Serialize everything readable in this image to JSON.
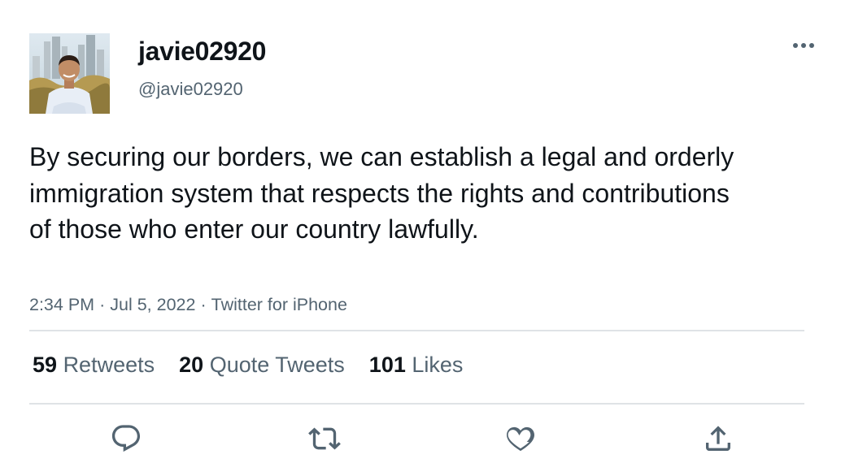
{
  "author": {
    "display_name": "javie02920",
    "handle": "@javie02920"
  },
  "tweet": {
    "text": "By securing our borders, we can establish a legal and orderly immigration system that respects the rights and contributions of those who enter our country lawfully.",
    "time": "2:34 PM",
    "separator": "·",
    "date": "Jul 5, 2022",
    "source": "Twitter for iPhone"
  },
  "stats": {
    "retweets_count": "59",
    "retweets_label": "Retweets",
    "quotes_count": "20",
    "quotes_label": "Quote Tweets",
    "likes_count": "101",
    "likes_label": "Likes"
  },
  "icons": {
    "more": "more-horizontal-icon",
    "reply": "reply-icon",
    "retweet": "retweet-icon",
    "like": "heart-icon",
    "share": "share-icon"
  },
  "colors": {
    "primary_text": "#0f1419",
    "secondary_text": "#536471",
    "divider": "#dfe3e6",
    "icon": "#536471"
  }
}
